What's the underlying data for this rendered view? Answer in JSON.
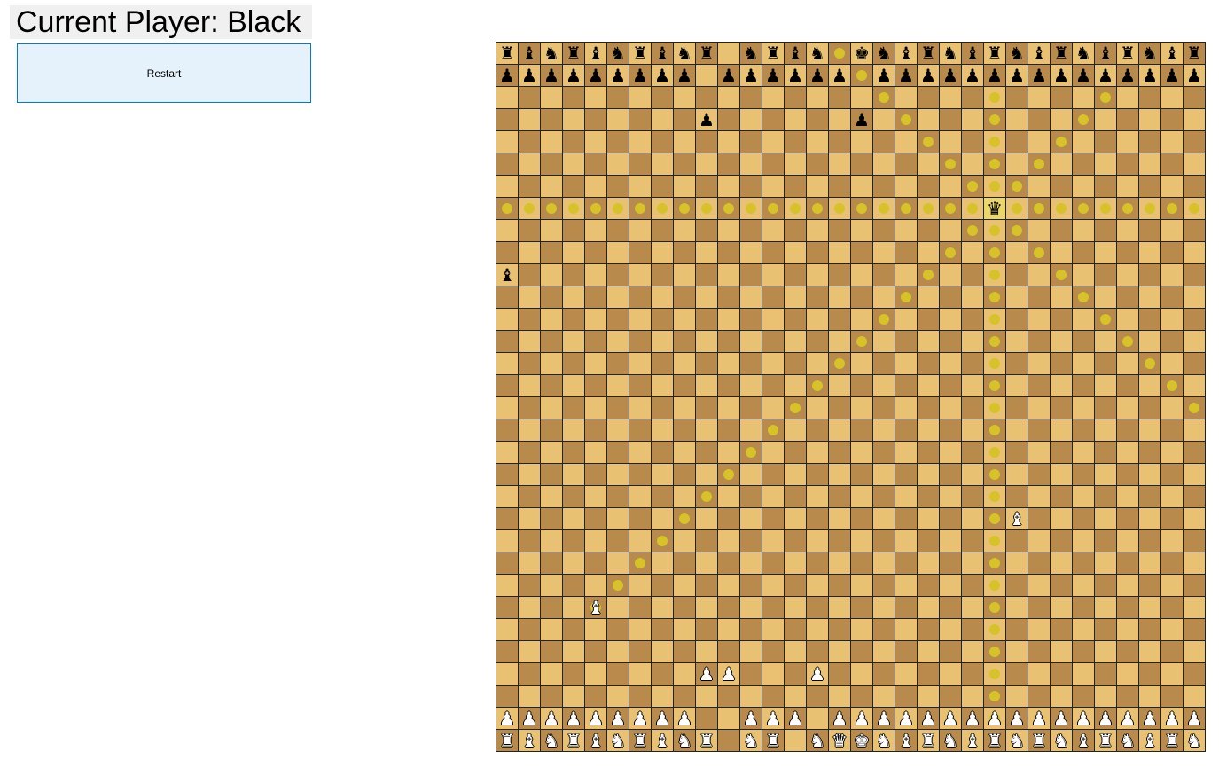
{
  "header": {
    "title": "Current Player: Black"
  },
  "controls": {
    "restart_label": "Restart"
  },
  "board": {
    "size": 32,
    "colors": {
      "light": "#e8c172",
      "dark": "#b88a4b",
      "move_dot": "#d7c229",
      "selected": "#e9d76a"
    },
    "glyphs": {
      "black": {
        "rook": "♜",
        "bishop": "♝",
        "knight": "♞",
        "queen": "♛",
        "king": "♚",
        "pawn": "♟"
      },
      "white": {
        "rook": "♜",
        "bishop": "♝",
        "knight": "♞",
        "queen": "♛",
        "king": "♚",
        "pawn": "♟"
      }
    },
    "pieces": [
      {
        "row": 0,
        "col": 0,
        "color": "black",
        "type": "rook"
      },
      {
        "row": 0,
        "col": 1,
        "color": "black",
        "type": "bishop"
      },
      {
        "row": 0,
        "col": 2,
        "color": "black",
        "type": "knight"
      },
      {
        "row": 0,
        "col": 3,
        "color": "black",
        "type": "rook"
      },
      {
        "row": 0,
        "col": 4,
        "color": "black",
        "type": "bishop"
      },
      {
        "row": 0,
        "col": 5,
        "color": "black",
        "type": "knight"
      },
      {
        "row": 0,
        "col": 6,
        "color": "black",
        "type": "rook"
      },
      {
        "row": 0,
        "col": 7,
        "color": "black",
        "type": "bishop"
      },
      {
        "row": 0,
        "col": 8,
        "color": "black",
        "type": "knight"
      },
      {
        "row": 0,
        "col": 9,
        "color": "black",
        "type": "rook"
      },
      {
        "row": 0,
        "col": 11,
        "color": "black",
        "type": "knight"
      },
      {
        "row": 0,
        "col": 12,
        "color": "black",
        "type": "rook"
      },
      {
        "row": 0,
        "col": 13,
        "color": "black",
        "type": "bishop"
      },
      {
        "row": 0,
        "col": 14,
        "color": "black",
        "type": "knight"
      },
      {
        "row": 0,
        "col": 16,
        "color": "black",
        "type": "king"
      },
      {
        "row": 0,
        "col": 17,
        "color": "black",
        "type": "knight"
      },
      {
        "row": 0,
        "col": 18,
        "color": "black",
        "type": "bishop"
      },
      {
        "row": 0,
        "col": 19,
        "color": "black",
        "type": "rook"
      },
      {
        "row": 0,
        "col": 20,
        "color": "black",
        "type": "knight"
      },
      {
        "row": 0,
        "col": 21,
        "color": "black",
        "type": "bishop"
      },
      {
        "row": 0,
        "col": 22,
        "color": "black",
        "type": "rook"
      },
      {
        "row": 0,
        "col": 23,
        "color": "black",
        "type": "knight"
      },
      {
        "row": 0,
        "col": 24,
        "color": "black",
        "type": "bishop"
      },
      {
        "row": 0,
        "col": 25,
        "color": "black",
        "type": "rook"
      },
      {
        "row": 0,
        "col": 26,
        "color": "black",
        "type": "knight"
      },
      {
        "row": 0,
        "col": 27,
        "color": "black",
        "type": "bishop"
      },
      {
        "row": 0,
        "col": 28,
        "color": "black",
        "type": "rook"
      },
      {
        "row": 0,
        "col": 29,
        "color": "black",
        "type": "knight"
      },
      {
        "row": 0,
        "col": 30,
        "color": "black",
        "type": "bishop"
      },
      {
        "row": 0,
        "col": 31,
        "color": "black",
        "type": "rook"
      },
      {
        "row": 1,
        "col": 0,
        "color": "black",
        "type": "pawn"
      },
      {
        "row": 1,
        "col": 1,
        "color": "black",
        "type": "pawn"
      },
      {
        "row": 1,
        "col": 2,
        "color": "black",
        "type": "pawn"
      },
      {
        "row": 1,
        "col": 3,
        "color": "black",
        "type": "pawn"
      },
      {
        "row": 1,
        "col": 4,
        "color": "black",
        "type": "pawn"
      },
      {
        "row": 1,
        "col": 5,
        "color": "black",
        "type": "pawn"
      },
      {
        "row": 1,
        "col": 6,
        "color": "black",
        "type": "pawn"
      },
      {
        "row": 1,
        "col": 7,
        "color": "black",
        "type": "pawn"
      },
      {
        "row": 1,
        "col": 8,
        "color": "black",
        "type": "pawn"
      },
      {
        "row": 1,
        "col": 10,
        "color": "black",
        "type": "pawn"
      },
      {
        "row": 1,
        "col": 11,
        "color": "black",
        "type": "pawn"
      },
      {
        "row": 1,
        "col": 12,
        "color": "black",
        "type": "pawn"
      },
      {
        "row": 1,
        "col": 13,
        "color": "black",
        "type": "pawn"
      },
      {
        "row": 1,
        "col": 14,
        "color": "black",
        "type": "pawn"
      },
      {
        "row": 1,
        "col": 15,
        "color": "black",
        "type": "pawn"
      },
      {
        "row": 1,
        "col": 17,
        "color": "black",
        "type": "pawn"
      },
      {
        "row": 1,
        "col": 18,
        "color": "black",
        "type": "pawn"
      },
      {
        "row": 1,
        "col": 19,
        "color": "black",
        "type": "pawn"
      },
      {
        "row": 1,
        "col": 20,
        "color": "black",
        "type": "pawn"
      },
      {
        "row": 1,
        "col": 21,
        "color": "black",
        "type": "pawn"
      },
      {
        "row": 1,
        "col": 22,
        "color": "black",
        "type": "pawn"
      },
      {
        "row": 1,
        "col": 23,
        "color": "black",
        "type": "pawn"
      },
      {
        "row": 1,
        "col": 24,
        "color": "black",
        "type": "pawn"
      },
      {
        "row": 1,
        "col": 25,
        "color": "black",
        "type": "pawn"
      },
      {
        "row": 1,
        "col": 26,
        "color": "black",
        "type": "pawn"
      },
      {
        "row": 1,
        "col": 27,
        "color": "black",
        "type": "pawn"
      },
      {
        "row": 1,
        "col": 28,
        "color": "black",
        "type": "pawn"
      },
      {
        "row": 1,
        "col": 29,
        "color": "black",
        "type": "pawn"
      },
      {
        "row": 1,
        "col": 30,
        "color": "black",
        "type": "pawn"
      },
      {
        "row": 1,
        "col": 31,
        "color": "black",
        "type": "pawn"
      },
      {
        "row": 3,
        "col": 9,
        "color": "black",
        "type": "pawn"
      },
      {
        "row": 3,
        "col": 16,
        "color": "black",
        "type": "pawn"
      },
      {
        "row": 7,
        "col": 22,
        "color": "black",
        "type": "queen"
      },
      {
        "row": 10,
        "col": 0,
        "color": "black",
        "type": "bishop"
      },
      {
        "row": 21,
        "col": 23,
        "color": "white",
        "type": "bishop"
      },
      {
        "row": 25,
        "col": 4,
        "color": "white",
        "type": "bishop"
      },
      {
        "row": 28,
        "col": 9,
        "color": "white",
        "type": "pawn"
      },
      {
        "row": 28,
        "col": 10,
        "color": "white",
        "type": "pawn"
      },
      {
        "row": 28,
        "col": 14,
        "color": "white",
        "type": "pawn"
      },
      {
        "row": 30,
        "col": 0,
        "color": "white",
        "type": "pawn"
      },
      {
        "row": 30,
        "col": 1,
        "color": "white",
        "type": "pawn"
      },
      {
        "row": 30,
        "col": 2,
        "color": "white",
        "type": "pawn"
      },
      {
        "row": 30,
        "col": 3,
        "color": "white",
        "type": "pawn"
      },
      {
        "row": 30,
        "col": 4,
        "color": "white",
        "type": "pawn"
      },
      {
        "row": 30,
        "col": 5,
        "color": "white",
        "type": "pawn"
      },
      {
        "row": 30,
        "col": 6,
        "color": "white",
        "type": "pawn"
      },
      {
        "row": 30,
        "col": 7,
        "color": "white",
        "type": "pawn"
      },
      {
        "row": 30,
        "col": 8,
        "color": "white",
        "type": "pawn"
      },
      {
        "row": 30,
        "col": 11,
        "color": "white",
        "type": "pawn"
      },
      {
        "row": 30,
        "col": 12,
        "color": "white",
        "type": "pawn"
      },
      {
        "row": 30,
        "col": 13,
        "color": "white",
        "type": "pawn"
      },
      {
        "row": 30,
        "col": 15,
        "color": "white",
        "type": "pawn"
      },
      {
        "row": 30,
        "col": 16,
        "color": "white",
        "type": "pawn"
      },
      {
        "row": 30,
        "col": 17,
        "color": "white",
        "type": "pawn"
      },
      {
        "row": 30,
        "col": 18,
        "color": "white",
        "type": "pawn"
      },
      {
        "row": 30,
        "col": 19,
        "color": "white",
        "type": "pawn"
      },
      {
        "row": 30,
        "col": 20,
        "color": "white",
        "type": "pawn"
      },
      {
        "row": 30,
        "col": 21,
        "color": "white",
        "type": "pawn"
      },
      {
        "row": 30,
        "col": 22,
        "color": "white",
        "type": "pawn"
      },
      {
        "row": 30,
        "col": 23,
        "color": "white",
        "type": "pawn"
      },
      {
        "row": 30,
        "col": 24,
        "color": "white",
        "type": "pawn"
      },
      {
        "row": 30,
        "col": 25,
        "color": "white",
        "type": "pawn"
      },
      {
        "row": 30,
        "col": 26,
        "color": "white",
        "type": "pawn"
      },
      {
        "row": 30,
        "col": 27,
        "color": "white",
        "type": "pawn"
      },
      {
        "row": 30,
        "col": 28,
        "color": "white",
        "type": "pawn"
      },
      {
        "row": 30,
        "col": 29,
        "color": "white",
        "type": "pawn"
      },
      {
        "row": 30,
        "col": 30,
        "color": "white",
        "type": "pawn"
      },
      {
        "row": 30,
        "col": 31,
        "color": "white",
        "type": "pawn"
      },
      {
        "row": 31,
        "col": 0,
        "color": "white",
        "type": "rook"
      },
      {
        "row": 31,
        "col": 1,
        "color": "white",
        "type": "bishop"
      },
      {
        "row": 31,
        "col": 2,
        "color": "white",
        "type": "knight"
      },
      {
        "row": 31,
        "col": 3,
        "color": "white",
        "type": "rook"
      },
      {
        "row": 31,
        "col": 4,
        "color": "white",
        "type": "bishop"
      },
      {
        "row": 31,
        "col": 5,
        "color": "white",
        "type": "knight"
      },
      {
        "row": 31,
        "col": 6,
        "color": "white",
        "type": "rook"
      },
      {
        "row": 31,
        "col": 7,
        "color": "white",
        "type": "bishop"
      },
      {
        "row": 31,
        "col": 8,
        "color": "white",
        "type": "knight"
      },
      {
        "row": 31,
        "col": 9,
        "color": "white",
        "type": "rook"
      },
      {
        "row": 31,
        "col": 11,
        "color": "white",
        "type": "knight"
      },
      {
        "row": 31,
        "col": 12,
        "color": "white",
        "type": "rook"
      },
      {
        "row": 31,
        "col": 14,
        "color": "white",
        "type": "knight"
      },
      {
        "row": 31,
        "col": 15,
        "color": "white",
        "type": "queen"
      },
      {
        "row": 31,
        "col": 16,
        "color": "white",
        "type": "king"
      },
      {
        "row": 31,
        "col": 17,
        "color": "white",
        "type": "knight"
      },
      {
        "row": 31,
        "col": 18,
        "color": "white",
        "type": "bishop"
      },
      {
        "row": 31,
        "col": 19,
        "color": "white",
        "type": "rook"
      },
      {
        "row": 31,
        "col": 20,
        "color": "white",
        "type": "knight"
      },
      {
        "row": 31,
        "col": 21,
        "color": "white",
        "type": "bishop"
      },
      {
        "row": 31,
        "col": 22,
        "color": "white",
        "type": "rook"
      },
      {
        "row": 31,
        "col": 23,
        "color": "white",
        "type": "knight"
      },
      {
        "row": 31,
        "col": 24,
        "color": "white",
        "type": "rook"
      },
      {
        "row": 31,
        "col": 25,
        "color": "white",
        "type": "knight"
      },
      {
        "row": 31,
        "col": 26,
        "color": "white",
        "type": "bishop"
      },
      {
        "row": 31,
        "col": 27,
        "color": "white",
        "type": "rook"
      },
      {
        "row": 31,
        "col": 28,
        "color": "white",
        "type": "knight"
      },
      {
        "row": 31,
        "col": 29,
        "color": "white",
        "type": "bishop"
      },
      {
        "row": 31,
        "col": 30,
        "color": "white",
        "type": "rook"
      },
      {
        "row": 31,
        "col": 31,
        "color": "white",
        "type": "knight"
      }
    ],
    "selected": {
      "row": 7,
      "col": 22
    },
    "move_hints": [
      [
        0,
        15
      ],
      [
        1,
        16
      ],
      [
        2,
        17
      ],
      [
        2,
        22
      ],
      [
        2,
        27
      ],
      [
        3,
        18
      ],
      [
        3,
        22
      ],
      [
        3,
        26
      ],
      [
        4,
        19
      ],
      [
        4,
        22
      ],
      [
        4,
        25
      ],
      [
        5,
        20
      ],
      [
        5,
        22
      ],
      [
        5,
        24
      ],
      [
        6,
        21
      ],
      [
        6,
        22
      ],
      [
        6,
        23
      ],
      [
        7,
        0
      ],
      [
        7,
        1
      ],
      [
        7,
        2
      ],
      [
        7,
        3
      ],
      [
        7,
        4
      ],
      [
        7,
        5
      ],
      [
        7,
        6
      ],
      [
        7,
        7
      ],
      [
        7,
        8
      ],
      [
        7,
        9
      ],
      [
        7,
        10
      ],
      [
        7,
        11
      ],
      [
        7,
        12
      ],
      [
        7,
        13
      ],
      [
        7,
        14
      ],
      [
        7,
        15
      ],
      [
        7,
        16
      ],
      [
        7,
        17
      ],
      [
        7,
        18
      ],
      [
        7,
        19
      ],
      [
        7,
        20
      ],
      [
        7,
        21
      ],
      [
        7,
        23
      ],
      [
        7,
        24
      ],
      [
        7,
        25
      ],
      [
        7,
        26
      ],
      [
        7,
        27
      ],
      [
        7,
        28
      ],
      [
        7,
        29
      ],
      [
        7,
        30
      ],
      [
        7,
        31
      ],
      [
        8,
        21
      ],
      [
        8,
        22
      ],
      [
        8,
        23
      ],
      [
        9,
        20
      ],
      [
        9,
        22
      ],
      [
        9,
        24
      ],
      [
        10,
        19
      ],
      [
        10,
        22
      ],
      [
        10,
        25
      ],
      [
        11,
        18
      ],
      [
        11,
        22
      ],
      [
        11,
        26
      ],
      [
        12,
        17
      ],
      [
        12,
        22
      ],
      [
        12,
        27
      ],
      [
        13,
        16
      ],
      [
        13,
        22
      ],
      [
        13,
        28
      ],
      [
        14,
        15
      ],
      [
        14,
        22
      ],
      [
        14,
        29
      ],
      [
        15,
        14
      ],
      [
        15,
        22
      ],
      [
        15,
        30
      ],
      [
        16,
        13
      ],
      [
        16,
        22
      ],
      [
        16,
        31
      ],
      [
        17,
        12
      ],
      [
        17,
        22
      ],
      [
        18,
        11
      ],
      [
        18,
        22
      ],
      [
        19,
        10
      ],
      [
        19,
        22
      ],
      [
        20,
        9
      ],
      [
        20,
        22
      ],
      [
        21,
        8
      ],
      [
        21,
        22
      ],
      [
        22,
        7
      ],
      [
        22,
        22
      ],
      [
        23,
        6
      ],
      [
        23,
        22
      ],
      [
        24,
        5
      ],
      [
        24,
        22
      ],
      [
        25,
        4
      ],
      [
        25,
        22
      ],
      [
        26,
        22
      ],
      [
        27,
        22
      ],
      [
        28,
        22
      ],
      [
        29,
        22
      ],
      [
        30,
        22
      ]
    ]
  }
}
